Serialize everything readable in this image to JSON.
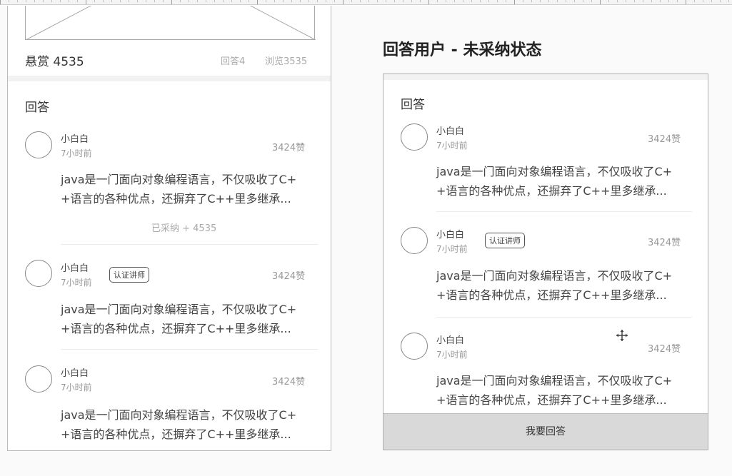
{
  "left_panel": {
    "bounty": "悬赏 4535",
    "answers_count": "回答4",
    "views_count": "浏览3535",
    "section_title": "回答",
    "answers": [
      {
        "name": "小白白",
        "time": "7小时前",
        "likes": "3424赞",
        "badge": "",
        "text_line1": "java是一门面向对象编程语言，不仅吸收了C+",
        "text_line2": "+语言的各种优点，还摒弃了C++里多继承...",
        "accepted": "已采纳 + 4535"
      },
      {
        "name": "小白白",
        "time": "7小时前",
        "likes": "3424赞",
        "badge": "认证讲师",
        "text_line1": "java是一门面向对象编程语言，不仅吸收了C+",
        "text_line2": "+语言的各种优点，还摒弃了C++里多继承...",
        "accepted": ""
      },
      {
        "name": "小白白",
        "time": "7小时前",
        "likes": "3424赞",
        "badge": "",
        "text_line1": "java是一门面向对象编程语言，不仅吸收了C+",
        "text_line2": "+语言的各种优点，还摒弃了C++里多继承...",
        "accepted": ""
      }
    ]
  },
  "right_panel": {
    "heading": "回答用户 - 未采纳状态",
    "section_title": "回答",
    "answers": [
      {
        "name": "小白白",
        "time": "7小时前",
        "likes": "3424赞",
        "badge": "",
        "text_line1": "java是一门面向对象编程语言，不仅吸收了C+",
        "text_line2": "+语言的各种优点，还摒弃了C++里多继承..."
      },
      {
        "name": "小白白",
        "time": "7小时前",
        "likes": "3424赞",
        "badge": "认证讲师",
        "text_line1": "java是一门面向对象编程语言，不仅吸收了C+",
        "text_line2": "+语言的各种优点，还摒弃了C++里多继承..."
      },
      {
        "name": "小白白",
        "time": "7小时前",
        "likes": "3424赞",
        "badge": "",
        "text_line1": "java是一门面向对象编程语言，不仅吸收了C+",
        "text_line2": "+语言的各种优点，还摒弃了C++里多继承..."
      }
    ],
    "reply_button": "我要回答"
  }
}
